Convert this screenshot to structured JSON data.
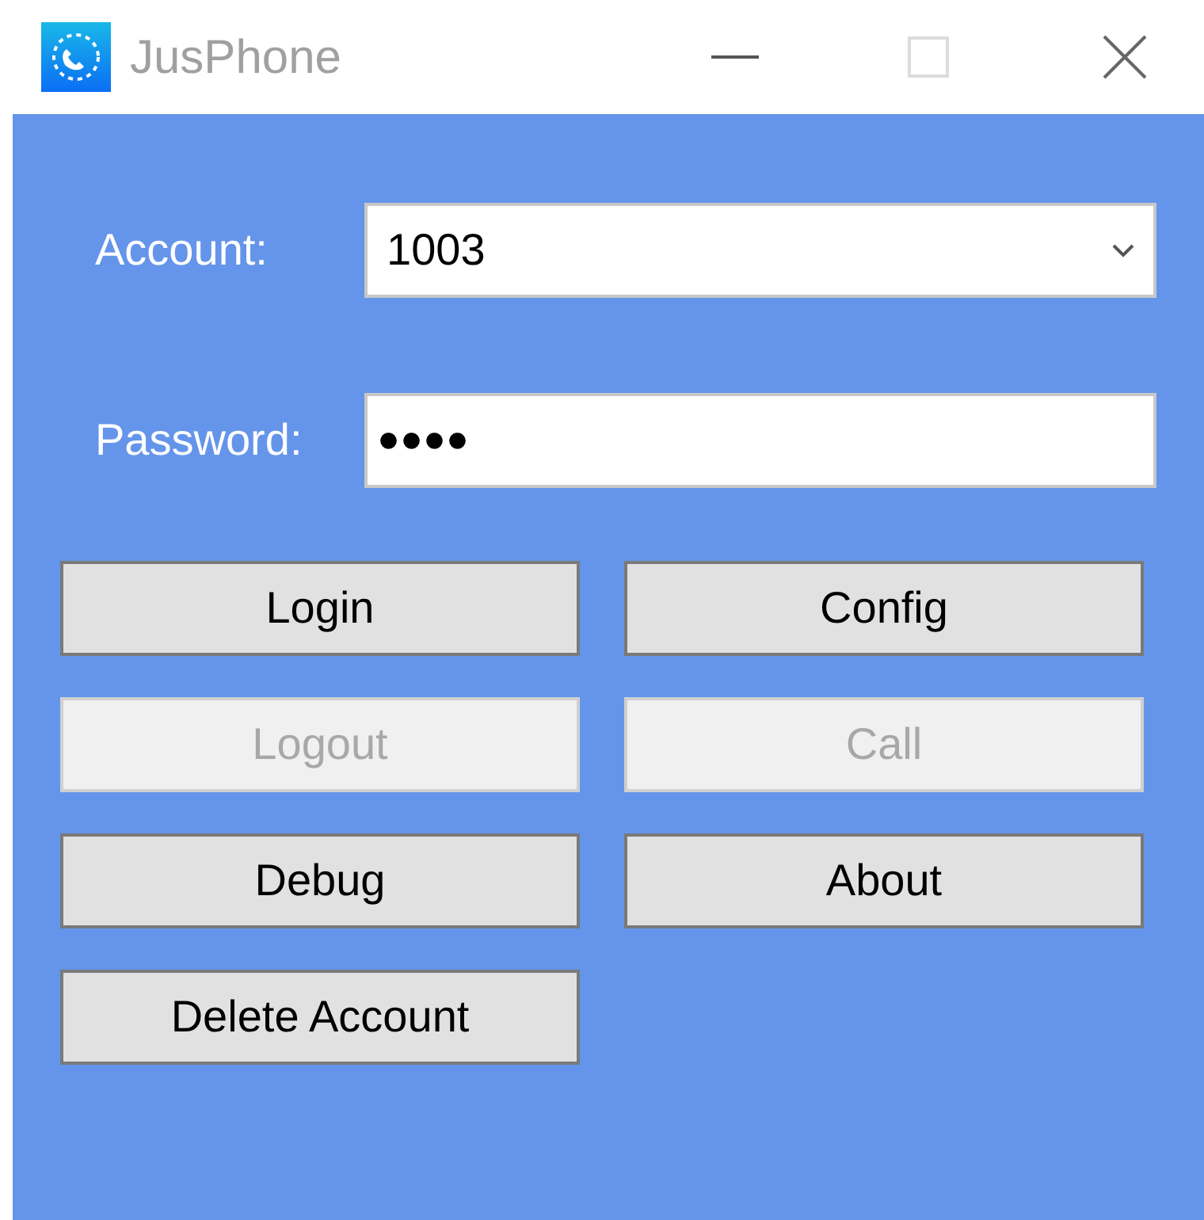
{
  "window": {
    "title": "JusPhone",
    "maximize_disabled": true
  },
  "account": {
    "label": "Account:",
    "value": "1003"
  },
  "password": {
    "label": "Password:",
    "value": "●●●●"
  },
  "buttons": [
    {
      "label": "Login",
      "disabled": false
    },
    {
      "label": "Config",
      "disabled": false
    },
    {
      "label": "Logout",
      "disabled": true
    },
    {
      "label": "Call",
      "disabled": true
    },
    {
      "label": "Debug",
      "disabled": false
    },
    {
      "label": "About",
      "disabled": false
    },
    {
      "label": "Delete Account",
      "disabled": false
    }
  ]
}
